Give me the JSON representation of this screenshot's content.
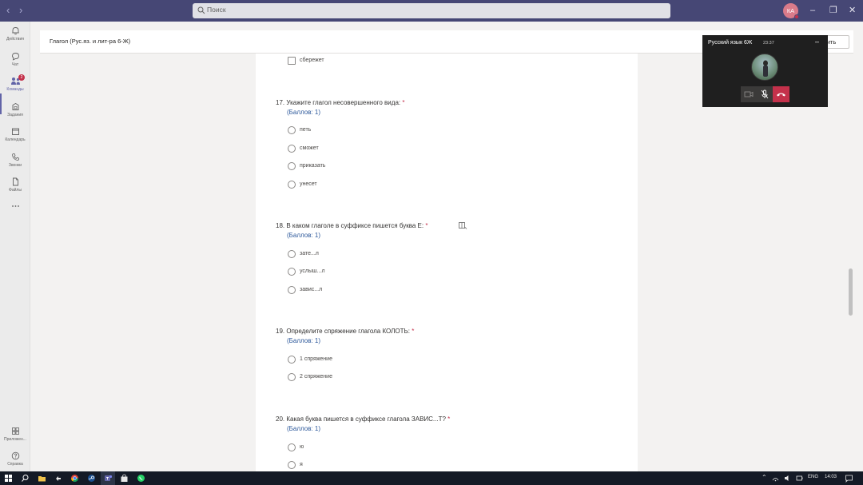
{
  "search": {
    "placeholder": "Поиск"
  },
  "user": {
    "initials": "КА"
  },
  "rail": [
    {
      "label": "Действия",
      "icon": "bell-icon"
    },
    {
      "label": "Чат",
      "icon": "chat-icon"
    },
    {
      "label": "Команды",
      "icon": "teams-icon",
      "badge": "2"
    },
    {
      "label": "Задания",
      "icon": "assignments-icon"
    },
    {
      "label": "Календарь",
      "icon": "calendar-icon"
    },
    {
      "label": "Звонки",
      "icon": "phone-icon"
    },
    {
      "label": "Файлы",
      "icon": "file-icon"
    },
    {
      "label": "...",
      "icon": "more-icon"
    },
    {
      "label": "Приложен...",
      "icon": "apps-icon"
    },
    {
      "label": "Справка",
      "icon": "help-icon"
    }
  ],
  "header": {
    "title": "Глагол (Рус.яз. и лит-ра 6-Ж)",
    "button_label": "ить"
  },
  "form": {
    "prev_option": "сбережет",
    "questions": [
      {
        "title": "17. Укажите глагол несовершенного вида:",
        "points": "(Баллов: 1)",
        "options": [
          "петь",
          "сможет",
          "приказать",
          "унесет"
        ]
      },
      {
        "title": "18. В каком глаголе в суффиксе пишется буква Е:",
        "points": "(Баллов: 1)",
        "options": [
          "зате...л",
          "услыш...л",
          "завис...л"
        ]
      },
      {
        "title": "19. Определите спряжение глагола КОЛОТЬ:",
        "points": "(Баллов: 1)",
        "options": [
          "1 спряжение",
          "2 спряжение"
        ]
      },
      {
        "title": "20. Какая буква пишется в суффиксе глагола ЗАВИС...Т?",
        "points": "(Баллов: 1)",
        "options": [
          "ю",
          "я"
        ]
      }
    ],
    "required_mark": "*"
  },
  "call": {
    "title": "Русский язык 6Ж",
    "time": "23:37",
    "minimize": "–"
  },
  "taskbar": {
    "lang": "ENG",
    "time": "14:03"
  },
  "colors": {
    "titlebar": "#464775",
    "accent": "#6264a7",
    "hangup": "#c4314b",
    "points": "#2b579a"
  }
}
